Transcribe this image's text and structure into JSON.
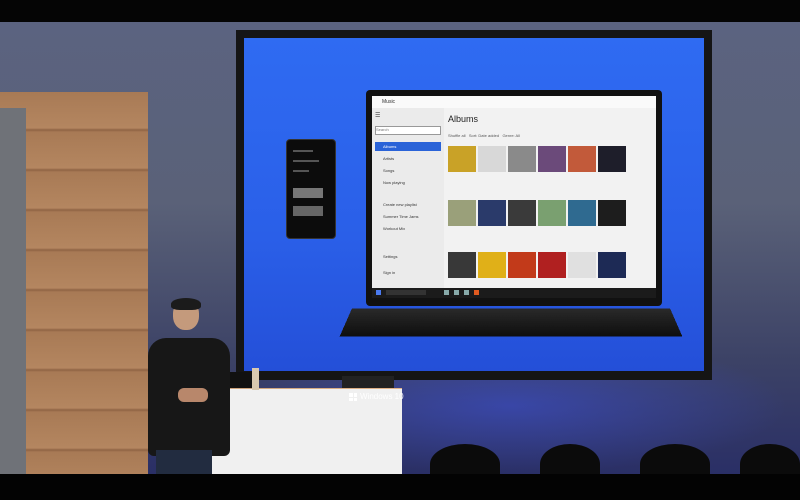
{
  "scene": {
    "description_labels": {
      "podium_brand": "Windows 10"
    }
  },
  "app": {
    "title": "Music",
    "search_placeholder": "Search",
    "page_title": "Albums",
    "toolbar": {
      "shuffle": "Shuffle all",
      "sort": "Sort: Date added",
      "filter": "Genre: All"
    },
    "sidebar_items": [
      {
        "label": "Albums",
        "active": true
      },
      {
        "label": "Artists",
        "active": false
      },
      {
        "label": "Songs",
        "active": false
      },
      {
        "label": "Now playing",
        "active": false
      },
      {
        "label": "Create new playlist",
        "active": false
      },
      {
        "label": "Summer Time Jams",
        "active": false
      },
      {
        "label": "Workout Mix",
        "active": false
      }
    ],
    "account": "Settings",
    "now_playing": "Sign in"
  },
  "colors": {
    "screen_blue": "#2a5fe8",
    "accent": "#2a63d8",
    "tiles": [
      "#c9a227",
      "#d8d8d8",
      "#8a8a8a",
      "#6b4a7a",
      "#c25a3a",
      "#1e1e2a",
      "#9aa07a",
      "#2a3a6a",
      "#3a3a3a",
      "#7aa070",
      "#2f6a90",
      "#1d1d1d",
      "#383838",
      "#e0b018",
      "#c23a1a",
      "#b02020",
      "#e0e0e0",
      "#1d2a55",
      "#d02020"
    ]
  }
}
